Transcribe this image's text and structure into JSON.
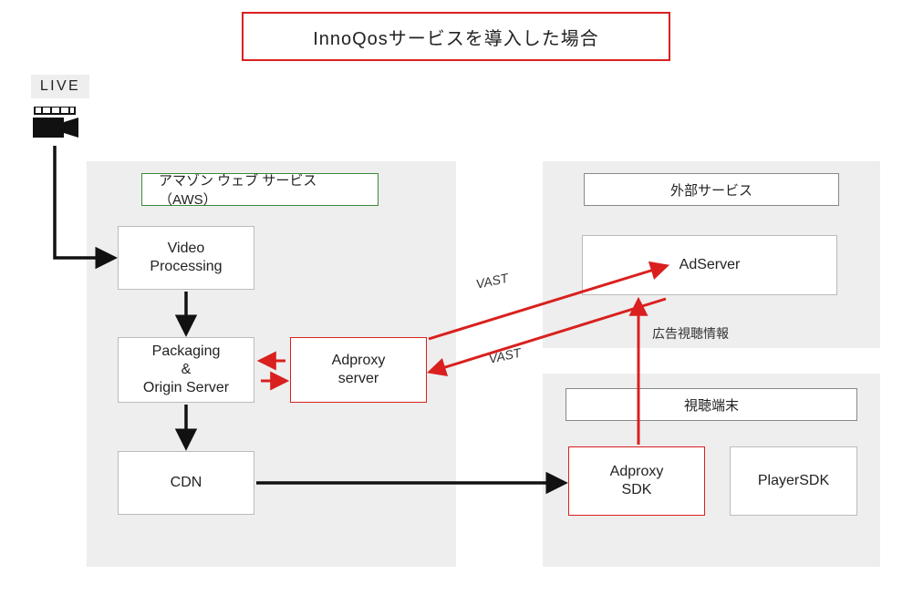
{
  "title": "InnoQosサービスを導入した場合",
  "live_label": "LIVE",
  "aws_panel_label": "アマゾン ウェブ サービス（AWS）",
  "external_panel_label": "外部サービス",
  "device_panel_label": "視聴端末",
  "nodes": {
    "video_processing": "Video\nProcessing",
    "packaging": "Packaging\n&\nOrigin Server",
    "cdn": "CDN",
    "adproxy_server": "Adproxy\nserver",
    "adserver": "AdServer",
    "adproxy_sdk": "Adproxy\nSDK",
    "player_sdk": "PlayerSDK"
  },
  "edge_labels": {
    "vast_up": "VAST",
    "vast_down": "VAST",
    "ad_view_info": "広告視聴情報"
  },
  "icons": {
    "camera": "video-camera-icon"
  }
}
